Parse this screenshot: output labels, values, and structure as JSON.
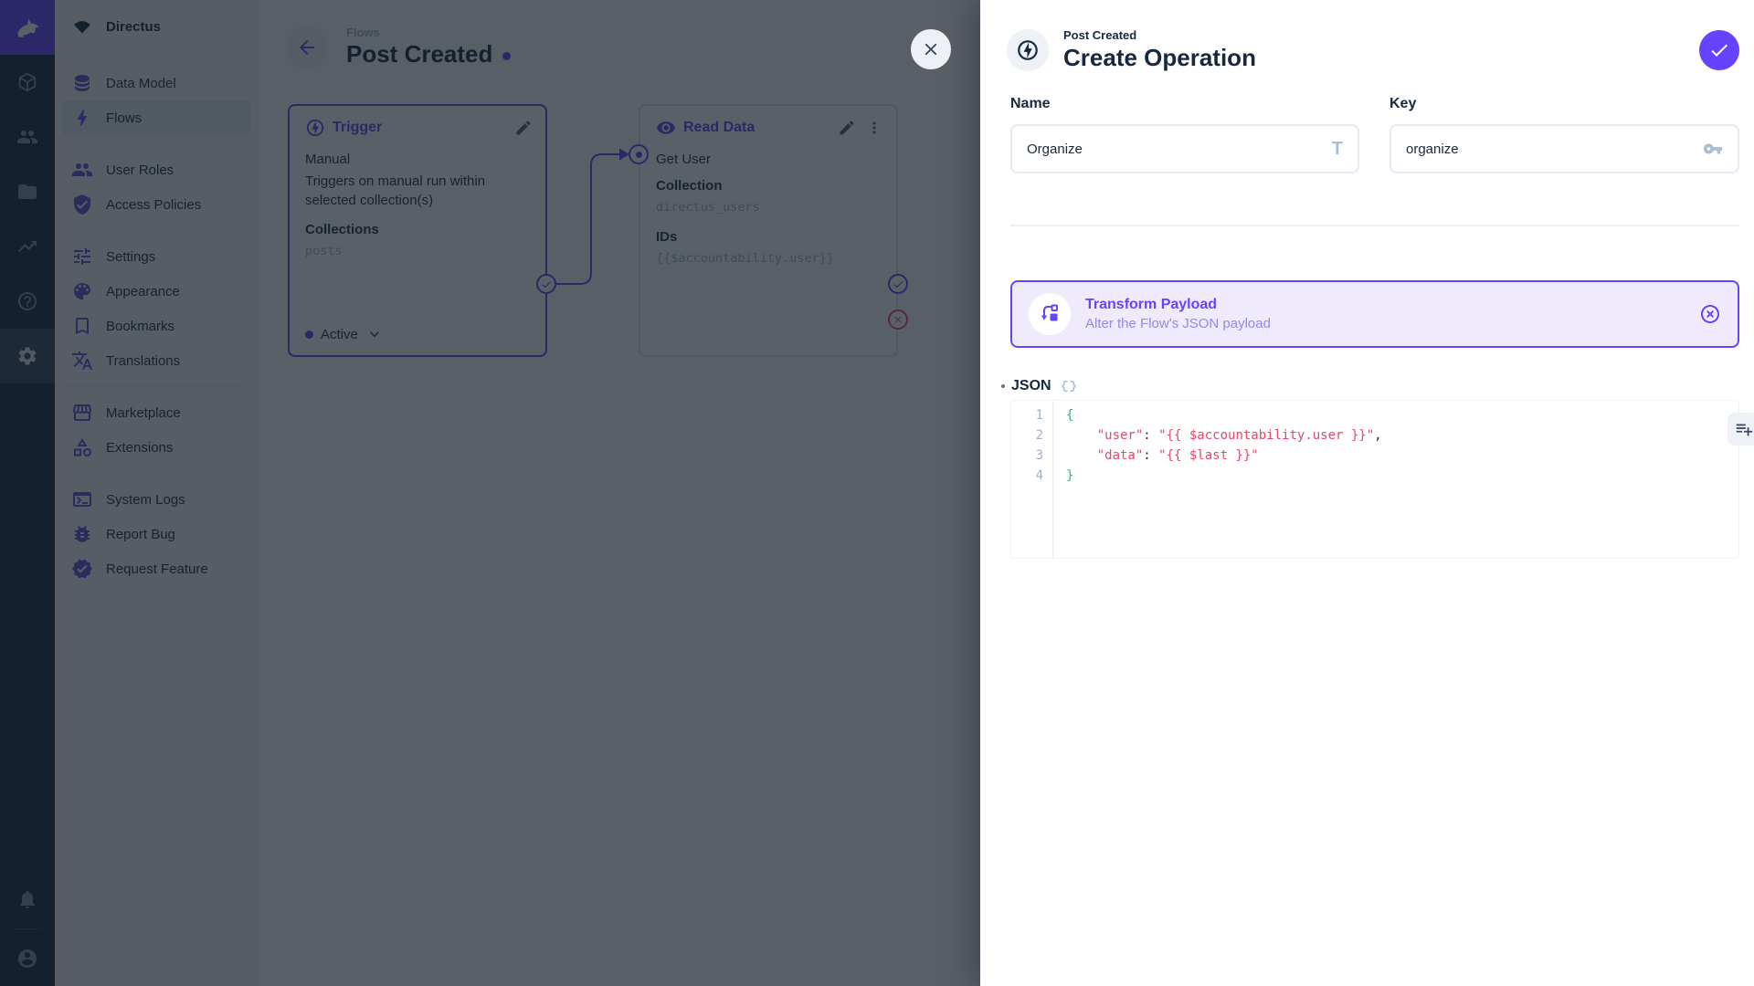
{
  "app": {
    "project_name": "Directus"
  },
  "colors": {
    "accent": "#6644ff",
    "danger": "#e35169",
    "string": "#e2486b",
    "brace": "#2bb673"
  },
  "modulebar": {
    "top": [
      {
        "icon": "box",
        "name": "content"
      },
      {
        "icon": "group",
        "name": "users"
      },
      {
        "icon": "folder",
        "name": "files"
      },
      {
        "icon": "trending",
        "name": "insights"
      },
      {
        "icon": "help",
        "name": "docs"
      },
      {
        "icon": "gear",
        "name": "settings",
        "active": true
      }
    ],
    "bottom": [
      {
        "icon": "bell",
        "name": "notifications"
      },
      {
        "icon": "account",
        "name": "user-avatar"
      }
    ]
  },
  "sidebar": {
    "sections": [
      [
        {
          "icon": "database",
          "label": "Data Model"
        },
        {
          "icon": "bolt",
          "label": "Flows",
          "active": true
        }
      ],
      [
        {
          "icon": "group",
          "label": "User Roles"
        },
        {
          "icon": "shield",
          "label": "Access Policies"
        }
      ],
      [
        {
          "icon": "tune",
          "label": "Settings"
        },
        {
          "icon": "palette",
          "label": "Appearance"
        },
        {
          "icon": "bookmark",
          "label": "Bookmarks"
        },
        {
          "icon": "translate",
          "label": "Translations"
        }
      ],
      [
        {
          "icon": "storefront",
          "label": "Marketplace"
        },
        {
          "icon": "category",
          "label": "Extensions"
        }
      ],
      [
        {
          "icon": "terminal",
          "label": "System Logs"
        },
        {
          "icon": "bug",
          "label": "Report Bug"
        },
        {
          "icon": "new_releases",
          "label": "Request Feature"
        }
      ]
    ]
  },
  "flow": {
    "breadcrumb": "Flows",
    "title": "Post Created",
    "trigger_panel": {
      "title": "Trigger",
      "type": "Manual",
      "description": "Triggers on manual run within selected collection(s)",
      "collections_label": "Collections",
      "collections_value": "posts",
      "status": "Active"
    },
    "read_data_panel": {
      "title": "Read Data",
      "name": "Get User",
      "collection_label": "Collection",
      "collection_value": "directus_users",
      "ids_label": "IDs",
      "ids_value": "{{$accountability.user}}"
    }
  },
  "drawer": {
    "breadcrumb": "Post Created",
    "title": "Create Operation",
    "name_field": {
      "label": "Name",
      "value": "Organize",
      "icon_label": "T"
    },
    "key_field": {
      "label": "Key",
      "value": "organize"
    },
    "operation_card": {
      "title": "Transform Payload",
      "subtitle": "Alter the Flow's JSON payload"
    },
    "json_field": {
      "label": "JSON",
      "lines": [
        "{",
        "    \"user\": \"{{ $accountability.user }}\",",
        "    \"data\": \"{{ $last }}\"",
        "}"
      ]
    }
  }
}
